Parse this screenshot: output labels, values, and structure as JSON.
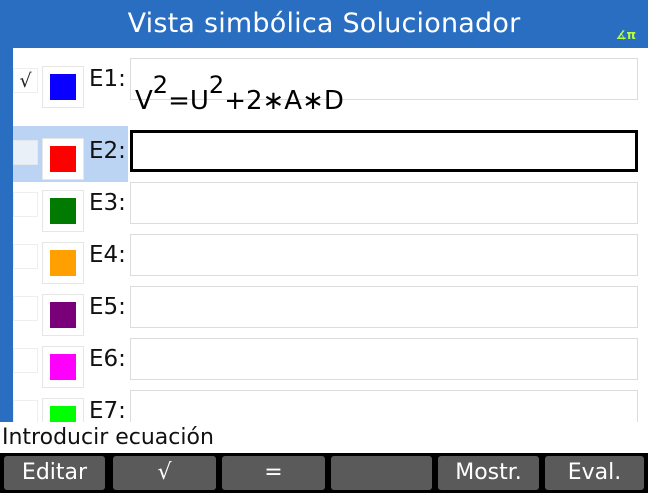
{
  "header": {
    "title": "Vista simbólica Solucionador",
    "angle_indicator": "∡π",
    "background": "#2a6ec2"
  },
  "equations": [
    {
      "checked": true,
      "check_mark": "√",
      "color": "#0a00ff",
      "label": "E1:",
      "expression": {
        "v": "V",
        "exp1": "2",
        "mid": "=U",
        "exp2": "2",
        "tail": "+2∗A∗D"
      }
    },
    {
      "checked": false,
      "check_mark": "",
      "color": "#ff0000",
      "label": "E2:",
      "selected": true
    },
    {
      "checked": false,
      "check_mark": "",
      "color": "#007a00",
      "label": "E3:"
    },
    {
      "checked": false,
      "check_mark": "",
      "color": "#ffa000",
      "label": "E4:"
    },
    {
      "checked": false,
      "check_mark": "",
      "color": "#7a007a",
      "label": "E5:"
    },
    {
      "checked": false,
      "check_mark": "",
      "color": "#ff00ff",
      "label": "E6:"
    },
    {
      "checked": false,
      "check_mark": "",
      "color": "#00ff00",
      "label": "E7:"
    }
  ],
  "status": {
    "text": "Introducir ecuación"
  },
  "softkeys": {
    "edit": "Editar",
    "check": "√",
    "equals": "=",
    "blank": "",
    "show": "Mostr.",
    "eval": "Eval."
  }
}
